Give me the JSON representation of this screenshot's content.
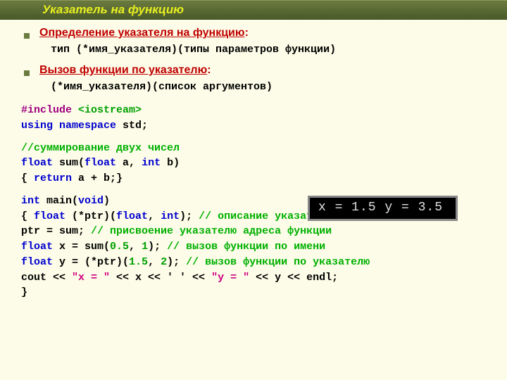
{
  "title": "Указатель на функцию",
  "def": {
    "heading": "Определение указателя на функцию",
    "syntax": "тип (*имя_указателя)(типы параметров функции)"
  },
  "call": {
    "heading": "Вызов функции по указателю",
    "syntax": "(*имя_указателя)(список аргументов)"
  },
  "code": {
    "include_kw": "#include",
    "include_hdr": "<iostream>",
    "using_kw": "using",
    "namespace_kw": "namespace",
    "std_txt": " std;",
    "comment_sum": "//суммирование двух  чисел",
    "float_kw": "float",
    "sum_sig_mid": " sum(",
    "float_a": " a, ",
    "int_kw": "int",
    "b_close": " b)",
    "sum_body_open": "{  ",
    "return_kw": "return",
    "sum_body_rest": " a + b;}",
    "main_sig_pre": " main(",
    "void_kw": "void",
    "main_sig_post": ")",
    "line1_a": "{ ",
    "line1_b": " (*ptr)(",
    "line1_c": ", ",
    "line1_d": ");   ",
    "line1_comment": "// описание указателя на функцию",
    "line2_a": "  ptr = sum;             ",
    "line2_comment": "// присвоение указателю адреса функции",
    "line3_a": "  ",
    "line3_b": " x = sum(",
    "line3_num1": "0.5",
    "line3_mid": ", ",
    "line3_num2": "1",
    "line3_c": ");      ",
    "line3_comment": "// вызов функции по имени",
    "line4_a": "  ",
    "line4_b": " y = (*ptr)(",
    "line4_num1": "1.5",
    "line4_mid": ", ",
    "line4_num2": "2",
    "line4_c": ");   ",
    "line4_comment": "// вызов функции по указателю",
    "cout_a": "  cout << ",
    "cout_s1": "\"x = \"",
    "cout_b": " << x << ' ' << ",
    "cout_s2": "\"y = \"",
    "cout_c": " << y << endl;",
    "close_brace": "}"
  },
  "console": "x = 1.5 y = 3.5"
}
